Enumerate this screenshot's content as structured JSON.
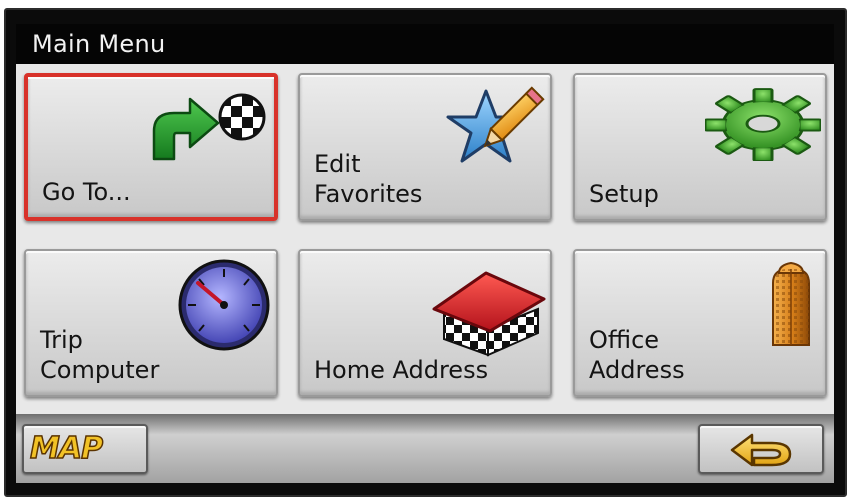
{
  "header": {
    "title": "Main Menu"
  },
  "menu": {
    "items": [
      {
        "label": "Go To...",
        "icon": "turn-arrow-checkered-flag-icon",
        "selected": true
      },
      {
        "label": "Edit\nFavorites",
        "icon": "star-pencil-icon",
        "selected": false
      },
      {
        "label": "Setup",
        "icon": "gear-icon",
        "selected": false
      },
      {
        "label": "Trip\nComputer",
        "icon": "speedometer-icon",
        "selected": false
      },
      {
        "label": "Home Address",
        "icon": "house-icon",
        "selected": false
      },
      {
        "label": "Office\nAddress",
        "icon": "office-building-icon",
        "selected": false
      }
    ]
  },
  "footer": {
    "map_label": "MAP",
    "back_icon": "back-arrow-icon"
  },
  "colors": {
    "selection_border": "#d8322a",
    "title_bar": "#050505",
    "map_text": "#f2c226"
  }
}
